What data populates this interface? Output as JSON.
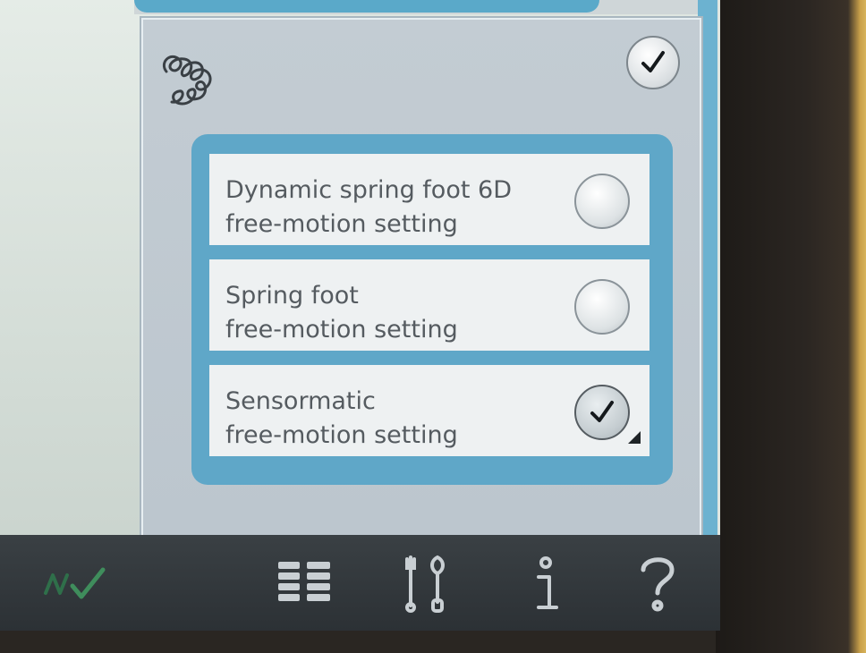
{
  "dialog": {
    "options": [
      {
        "line1": "Dynamic spring foot 6D",
        "line2": "free-motion setting",
        "selected": false
      },
      {
        "line1": "Spring foot",
        "line2": "free-motion setting",
        "selected": false
      },
      {
        "line1": "Sensormatic",
        "line2": "free-motion setting",
        "selected": true
      }
    ]
  },
  "toolbar": {
    "icons": [
      "stitch-check-icon",
      "menu-grid-icon",
      "tools-icon",
      "info-icon",
      "help-icon"
    ]
  },
  "colors": {
    "panel_blue": "#5fa7c8",
    "dialog_gray": "#c3ccd3",
    "option_bg": "#eef1f2",
    "toolbar_dark": "#2c3135",
    "stitch_icon_green": "#2f6f4a"
  }
}
